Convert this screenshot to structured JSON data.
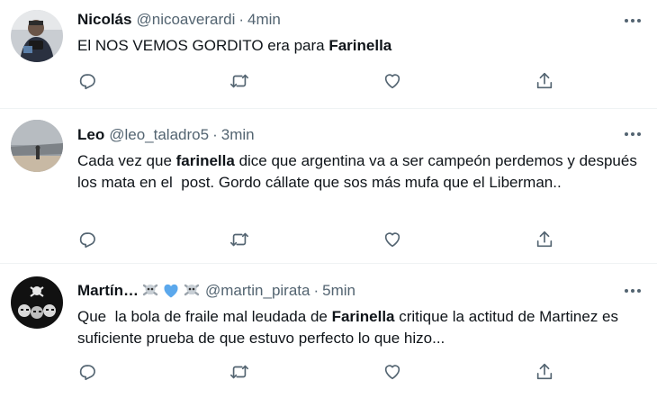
{
  "colors": {
    "text": "#0f1419",
    "secondary": "#536471",
    "divider": "#eff3f4",
    "heart_emoji": "#5ba8ec"
  },
  "tweets": [
    {
      "name": "Nicolás",
      "handle": "@nicoaverardi",
      "separator": "·",
      "time": "4min",
      "text_before": "El NOS VEMOS GORDITO era para ",
      "text_bold": "Farinella",
      "text_after": "",
      "avatar": "avatar-photo-person-with-camera"
    },
    {
      "name": "Leo",
      "handle": "@leo_taladro5",
      "separator": "·",
      "time": "3min",
      "text_before": "Cada vez que ",
      "text_bold": "farinella",
      "text_after": " dice que argentina va a ser campeón perdemos y después los mata en el  post. Gordo cállate que sos más mufa que el Liberman..",
      "avatar": "avatar-photo-beach"
    },
    {
      "name": "Martín…",
      "emojis": [
        "skull-crossbones-icon",
        "blue-heart-icon",
        "skull-crossbones-icon"
      ],
      "handle": "@martin_pirata",
      "separator": "·",
      "time": "5min",
      "text_before": "Que  la bola de fraile mal leudada de ",
      "text_bold": "Farinella",
      "text_after": " critique la actitud de Martinez es suficiente prueba de que estuvo perfecto lo que hizo...",
      "avatar": "avatar-pirate-skulls"
    }
  ],
  "action_icons": [
    "reply-icon",
    "retweet-icon",
    "like-icon",
    "share-icon"
  ],
  "more_icon": "more-options-icon"
}
